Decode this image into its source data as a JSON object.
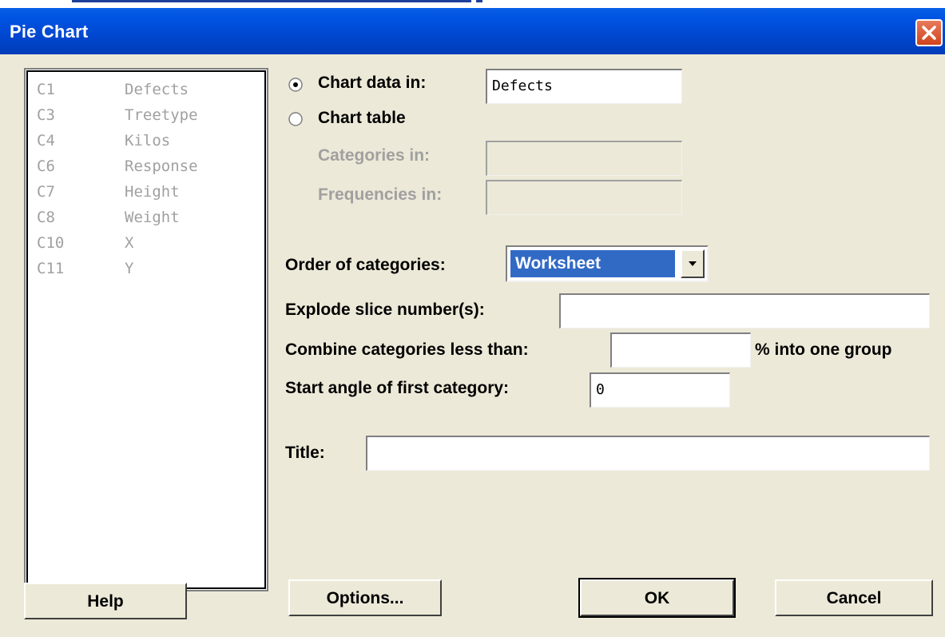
{
  "window": {
    "title": "Pie Chart"
  },
  "variables": [
    {
      "col": "C1",
      "name": "Defects"
    },
    {
      "col": "C3",
      "name": "Treetype"
    },
    {
      "col": "C4",
      "name": "Kilos"
    },
    {
      "col": "C6",
      "name": "Response"
    },
    {
      "col": "C7",
      "name": "Height"
    },
    {
      "col": "C8",
      "name": "Weight"
    },
    {
      "col": "C10",
      "name": "X"
    },
    {
      "col": "C11",
      "name": "Y"
    }
  ],
  "source": {
    "chart_data_in_label": "Chart data in:",
    "chart_data_in_value": "Defects",
    "chart_data_in_selected": true,
    "chart_table_label": "Chart table",
    "chart_table_selected": false,
    "categories_in_label": "Categories in:",
    "categories_in_value": "",
    "frequencies_in_label": "Frequencies in:",
    "frequencies_in_value": ""
  },
  "options": {
    "order_label": "Order of categories:",
    "order_value": "Worksheet",
    "explode_label": "Explode slice number(s):",
    "explode_value": "",
    "combine_label": "Combine categories less than:",
    "combine_value": "",
    "combine_suffix": "% into one group",
    "start_angle_label": "Start angle of first category:",
    "start_angle_value": "0",
    "title_label": "Title:",
    "title_value": ""
  },
  "buttons": {
    "help": "Help",
    "options": "Options...",
    "ok": "OK",
    "cancel": "Cancel"
  },
  "colors": {
    "titlebar": "#0054e3",
    "dialog_bg": "#ece9d8",
    "selection": "#316ac5",
    "close_button": "#d2431c"
  }
}
